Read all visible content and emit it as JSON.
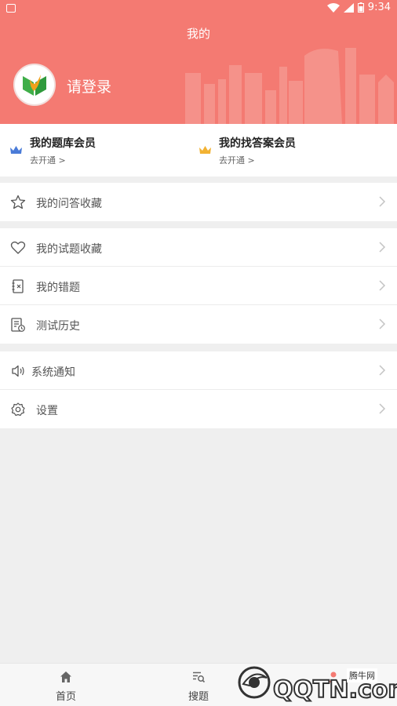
{
  "status": {
    "time": "9:34"
  },
  "header": {
    "title": "我的",
    "login_text": "请登录"
  },
  "members": [
    {
      "title": "我的题库会员",
      "subtitle": "去开通 >",
      "crown_color": "#4a7bd8"
    },
    {
      "title": "我的找答案会员",
      "subtitle": "去开通 >",
      "crown_color": "#f2b233"
    }
  ],
  "menu": {
    "group1": [
      {
        "label": "我的问答收藏",
        "icon": "star-icon"
      }
    ],
    "group2": [
      {
        "label": "我的试题收藏",
        "icon": "heart-icon"
      },
      {
        "label": "我的错题",
        "icon": "notebook-icon"
      },
      {
        "label": "测试历史",
        "icon": "history-icon"
      }
    ],
    "group3": [
      {
        "label": "系统通知",
        "icon": "speaker-icon"
      },
      {
        "label": "设置",
        "icon": "gear-icon"
      }
    ]
  },
  "tabbar": [
    {
      "label": "首页",
      "icon": "home-icon"
    },
    {
      "label": "搜题",
      "icon": "search-list-icon"
    },
    {
      "label": "",
      "icon": "user-icon"
    }
  ],
  "watermark": {
    "text": "QQTN.com",
    "brand": "腾牛网"
  },
  "colors": {
    "header": "#f47a72",
    "background": "#efefef"
  }
}
